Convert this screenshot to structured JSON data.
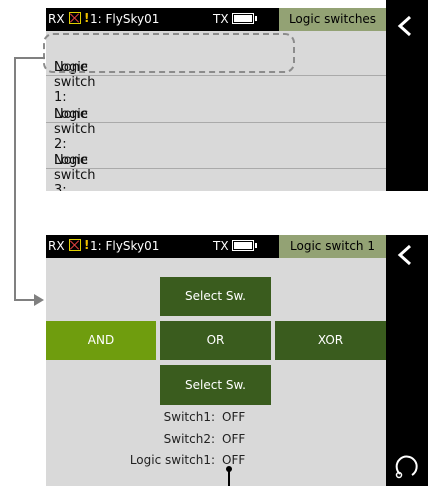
{
  "top_screen": {
    "statusbar": {
      "rx": "RX",
      "model": "1: FlySky01",
      "tx": "TX",
      "title": "Logic switches"
    },
    "items": [
      {
        "label": "Logic switch 1:",
        "value": "None"
      },
      {
        "label": "Logic switch 2:",
        "value": "None"
      },
      {
        "label": "Logic switch 3:",
        "value": "None"
      }
    ]
  },
  "bottom_screen": {
    "statusbar": {
      "rx": "RX",
      "model": "1: FlySky01",
      "tx": "TX",
      "title": "Logic switch 1"
    },
    "select_top": "Select Sw.",
    "select_bottom": "Select Sw.",
    "ops": {
      "and": "AND",
      "or": "OR",
      "xor": "XOR"
    },
    "selected_op": "AND",
    "info": [
      {
        "label": "Switch1:",
        "value": "OFF"
      },
      {
        "label": "Switch2:",
        "value": "OFF"
      },
      {
        "label": "Logic switch1:",
        "value": "OFF"
      }
    ]
  },
  "icons": {
    "back": "chevron-left-icon",
    "undo": "undo-icon",
    "warning": "warning-icon",
    "rx_status": "rx-disconnected-icon",
    "battery": "battery-icon"
  },
  "colors": {
    "accent": "#6f9d0e",
    "dark_green": "#3a5c1e",
    "title_bg": "#93a274",
    "screen_bg": "#d9d9d9"
  }
}
